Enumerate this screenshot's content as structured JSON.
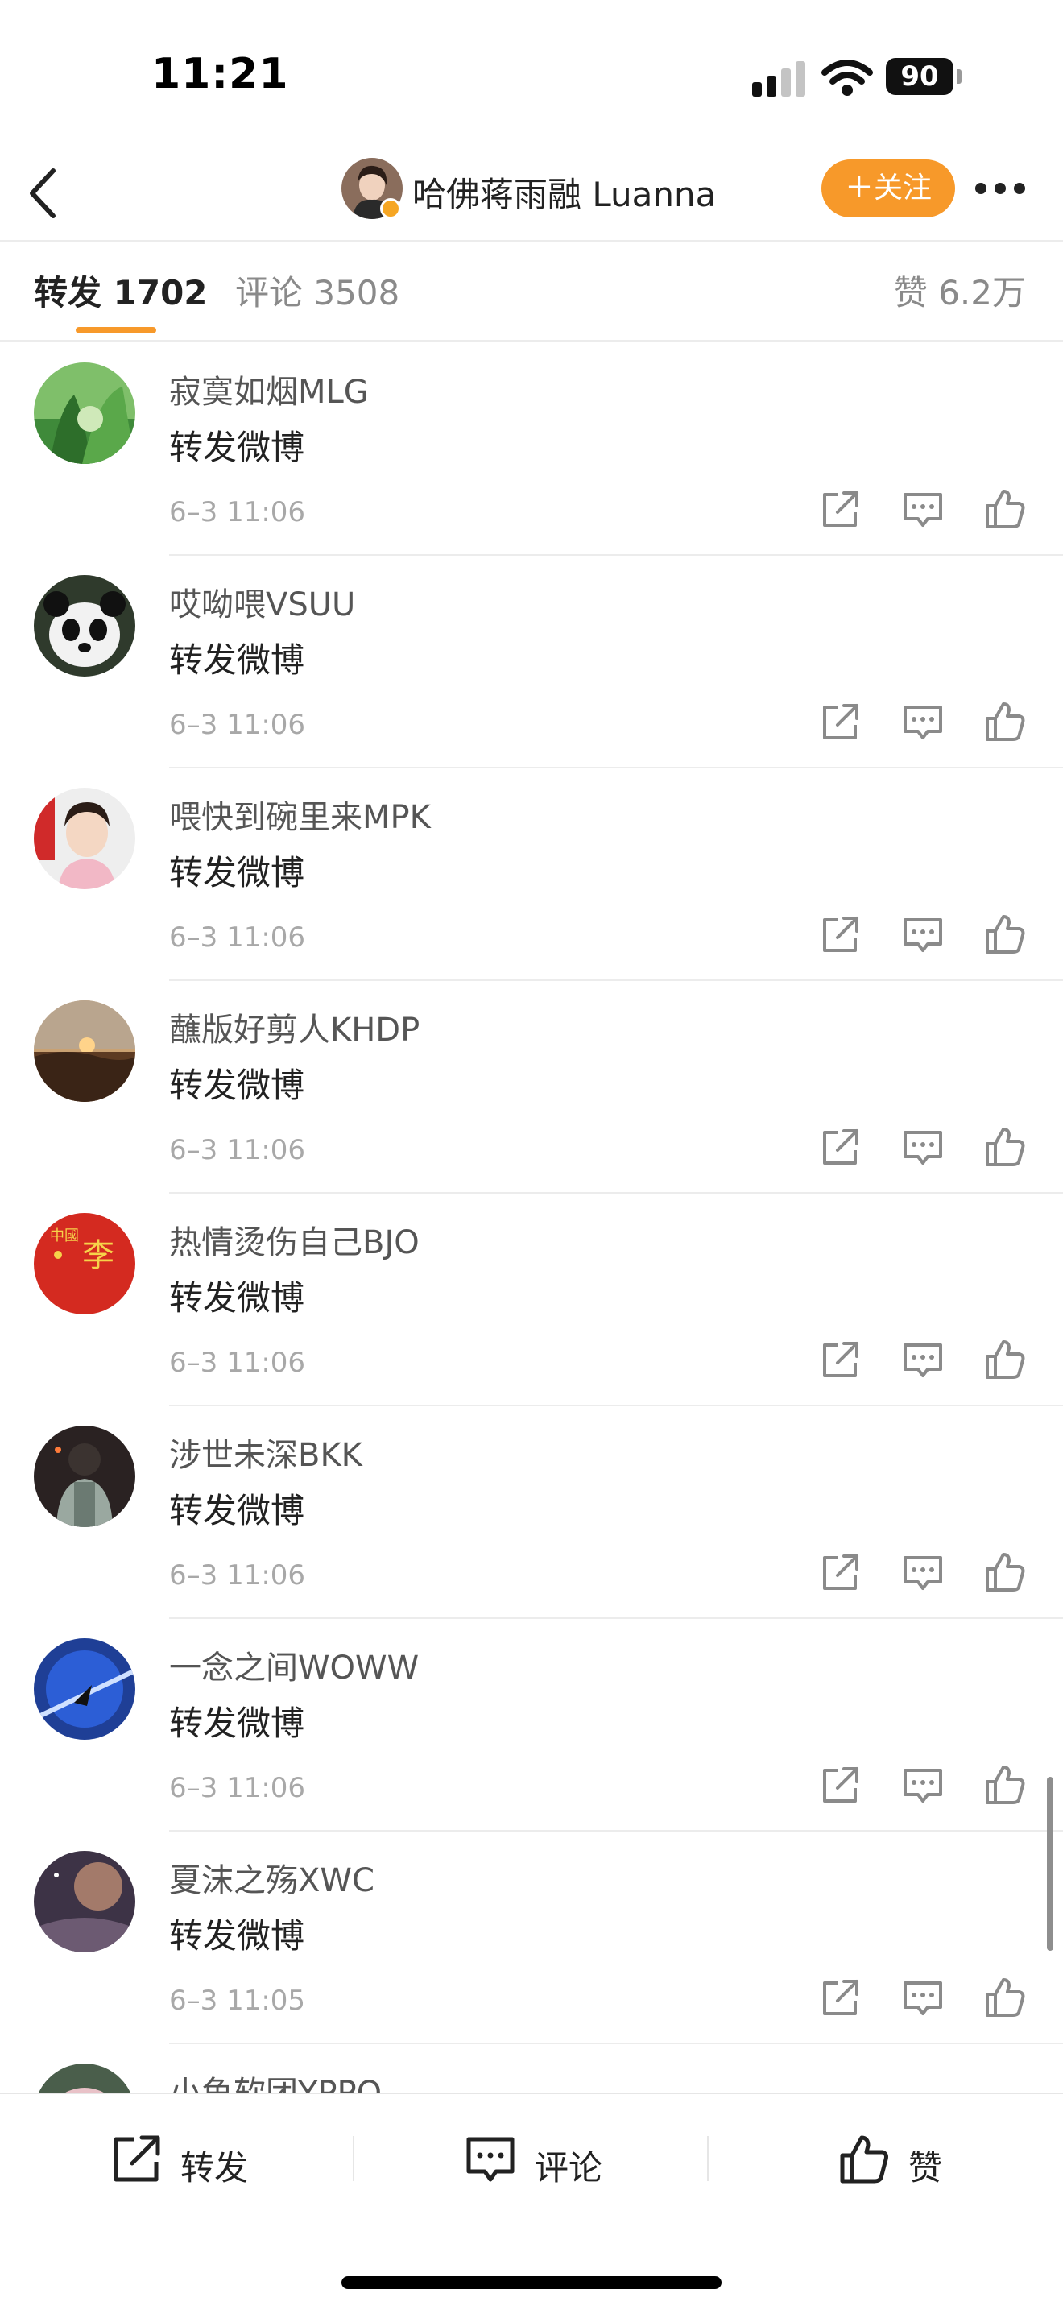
{
  "status_bar": {
    "time": "11:21",
    "battery": "90"
  },
  "nav": {
    "author_name": "哈佛蒋雨融 Luanna",
    "follow_label": "＋关注"
  },
  "tabs": {
    "reposts": "转发 1702",
    "comments": "评论 3508",
    "likes": "赞 6.2万"
  },
  "reposts": [
    {
      "name": "寂寞如烟MLG",
      "text": "转发微博",
      "time": "6–3 11:06",
      "avatar": "forest"
    },
    {
      "name": "哎呦喂VSUU",
      "text": "转发微博",
      "time": "6–3 11:06",
      "avatar": "panda"
    },
    {
      "name": "喂快到碗里来MPK",
      "text": "转发微博",
      "time": "6–3 11:06",
      "avatar": "girl"
    },
    {
      "name": "蘸版好剪人KHDP",
      "text": "转发微博",
      "time": "6–3 11:06",
      "avatar": "sunset"
    },
    {
      "name": "热情烫伤自己BJO",
      "text": "转发微博",
      "time": "6–3 11:06",
      "avatar": "red"
    },
    {
      "name": "涉世未深BKK",
      "text": "转发微博",
      "time": "6–3 11:06",
      "avatar": "soldier"
    },
    {
      "name": "一念之间WOWW",
      "text": "转发微博",
      "time": "6–3 11:06",
      "avatar": "blue"
    },
    {
      "name": "夏沫之殇XWC",
      "text": "转发微博",
      "time": "6–3 11:05",
      "avatar": "planet"
    },
    {
      "name": "小鱼软团YPPQ",
      "text": "",
      "time": "",
      "avatar": "pink"
    }
  ],
  "bottom_bar": {
    "repost_label": "转发",
    "comment_label": "评论",
    "like_label": "赞"
  },
  "colors": {
    "accent": "#f7992a",
    "text_primary": "#222222",
    "text_secondary": "#8a8a8a",
    "timestamp": "#a8a8a8",
    "divider": "#ececec"
  }
}
